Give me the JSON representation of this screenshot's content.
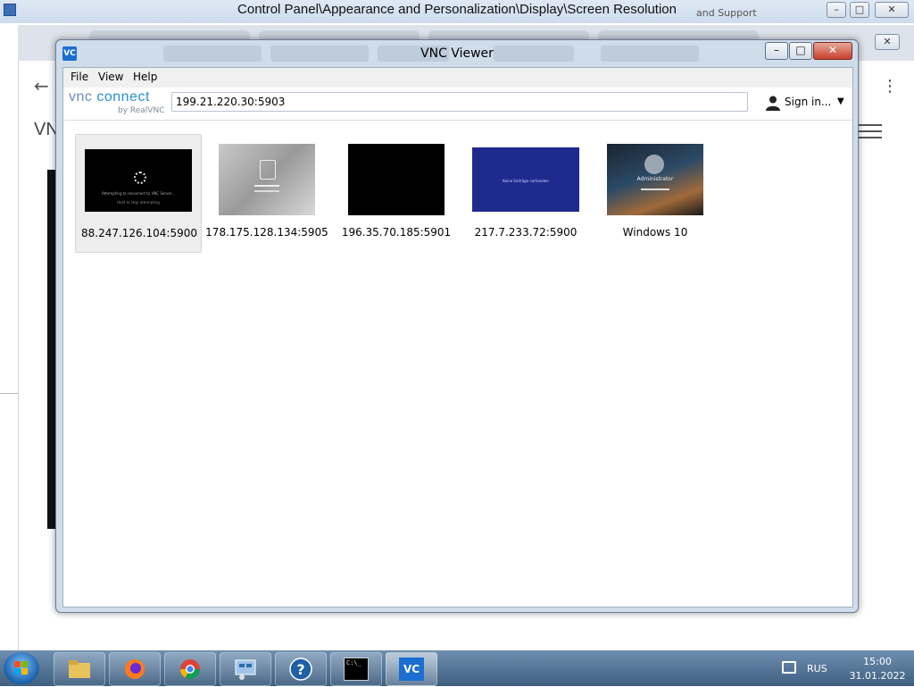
{
  "background_window": {
    "title": "Control Panel\\Appearance and Personalization\\Display\\Screen Resolution",
    "minimize": "–",
    "maximize": "□",
    "close": "✕",
    "browser_back": "←",
    "page_heading_fragment": "VN",
    "kebab": "⋮",
    "support_fragment": "and Support"
  },
  "vnc": {
    "title": "VNC Viewer",
    "app_icon": "VC",
    "window_controls": {
      "minimize": "–",
      "maximize": "□",
      "close": "✕"
    },
    "menu": [
      "File",
      "View",
      "Help"
    ],
    "logo": {
      "main_a": "vnc ",
      "main_b": "connect",
      "sub": "by RealVNC"
    },
    "address_value": "199.21.220.30:5903",
    "signin_label": "Sign in...",
    "signin_caret": "▼",
    "connections": [
      {
        "label": "88.247.126.104:5900",
        "selected": true,
        "caption1": "Attempting to reconnect to VNC Server...",
        "caption2": "Hold to stop attempting"
      },
      {
        "label": "178.175.128.134:5905",
        "selected": false
      },
      {
        "label": "196.35.70.185:5901",
        "selected": false
      },
      {
        "label": "217.7.233.72:5900",
        "selected": false,
        "caption1": "Keine Einträge vorhanden"
      },
      {
        "label": "Windows 10",
        "selected": false,
        "caption1": "Administrator"
      }
    ]
  },
  "taskbar": {
    "items": [
      "start-orb",
      "explorer-icon",
      "firefox-icon",
      "chrome-icon",
      "control-panel-icon",
      "help-icon",
      "cmd-icon",
      "vnc-viewer-icon"
    ],
    "cmd_text": "C:\\_",
    "help_text": "?",
    "vnc_text": "VC",
    "tray": {
      "language": "RUS",
      "time": "15:00",
      "date": "31.01.2022"
    }
  },
  "colors": {
    "accent": "#2b8fd6",
    "vnc_blue": "#1a6fd1",
    "titlebar": "#cfdcea",
    "selected_tile": "#ededed"
  }
}
